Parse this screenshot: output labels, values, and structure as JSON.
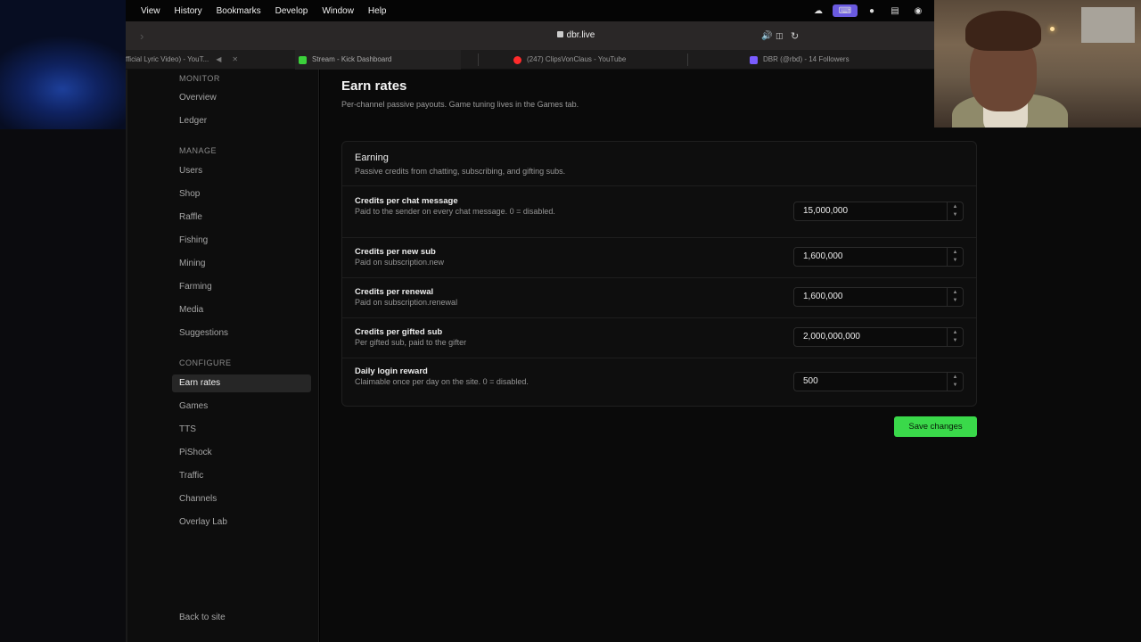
{
  "menubar": {
    "items": [
      "View",
      "History",
      "Bookmarks",
      "Develop",
      "Window",
      "Help"
    ]
  },
  "browser": {
    "url": "dbr.live",
    "tabs": [
      {
        "title": "fficial Lyric Video) - YouT...",
        "favicon_color": "#444444"
      },
      {
        "title": "Stream - Kick Dashboard",
        "favicon_color": "#3bd13b"
      },
      {
        "title": "(247) ClipsVonClaus - YouTube",
        "favicon_color": "#ff2b2b"
      },
      {
        "title": "DBR (@rbd) - 14 Followers",
        "favicon_color": "#7a5cff"
      }
    ]
  },
  "sidebar": {
    "sections": [
      {
        "label": "MONITOR",
        "items": [
          "Overview",
          "Ledger"
        ]
      },
      {
        "label": "MANAGE",
        "items": [
          "Users",
          "Shop",
          "Raffle",
          "Fishing",
          "Mining",
          "Farming",
          "Media",
          "Suggestions"
        ]
      },
      {
        "label": "CONFIGURE",
        "items": [
          "Earn rates",
          "Games",
          "TTS",
          "PiShock",
          "Traffic",
          "Channels",
          "Overlay Lab"
        ]
      }
    ],
    "active_item": "Earn rates",
    "back_link": "Back to site"
  },
  "main": {
    "title": "Earn rates",
    "subtitle": "Per-channel passive payouts. Game tuning lives in the Games tab.",
    "card": {
      "title": "Earning",
      "description": "Passive credits from chatting, subscribing, and gifting subs.",
      "rows": [
        {
          "label": "Credits per chat message",
          "help": "Paid to the sender on every chat message. 0 = disabled.",
          "value": "15,000,000"
        },
        {
          "label": "Credits per new sub",
          "help": "Paid on subscription.new",
          "value": "1,600,000"
        },
        {
          "label": "Credits per renewal",
          "help": "Paid on subscription.renewal",
          "value": "1,600,000"
        },
        {
          "label": "Credits per gifted sub",
          "help": "Per gifted sub, paid to the gifter",
          "value": "2,000,000,000"
        },
        {
          "label": "Daily login reward",
          "help": "Claimable once per day on the site. 0 = disabled.",
          "value": "500"
        }
      ]
    },
    "save_label": "Save changes"
  },
  "colors": {
    "accent_green": "#3ad94a",
    "active_nav_bg": "#262626",
    "page_bg": "#0a0a0a"
  },
  "icons": [
    "lock-icon",
    "audio-icon",
    "translate-icon",
    "reload-icon",
    "back-chevron-icon",
    "stepper-icon"
  ]
}
